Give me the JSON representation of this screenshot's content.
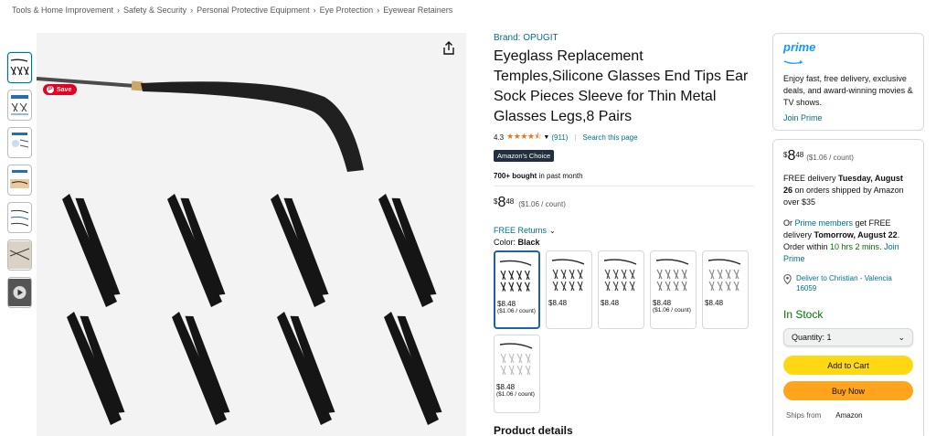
{
  "breadcrumb": [
    "Tools & Home Improvement",
    "Safety & Security",
    "Personal Protective Equipment",
    "Eye Protection",
    "Eyewear Retainers"
  ],
  "breadcrumb_separator": "›",
  "gallery": {
    "save_label": "Save",
    "thumbnail_icons": [
      "product-thumbnail",
      "infographic-thumbnail",
      "infographic-thumbnail",
      "infographic-thumbnail",
      "infographic-thumbnail",
      "lifestyle-thumbnail",
      "video-thumbnail"
    ]
  },
  "product": {
    "brand": "Brand: OPUGIT",
    "title": "Eyeglass Replacement Temples,Silicone Glasses End Tips Ear Sock Pieces Sleeve for Thin Metal Glasses Legs,8 Pairs",
    "rating": "4.3",
    "stars": "★★★★⯪",
    "rating_count": "(911)",
    "search_link": "Search this page",
    "badge": "Amazon's Choice",
    "bought_bold": "700+ bought",
    "bought_rest": " in past month",
    "price_symbol": "$",
    "price_whole": "8",
    "price_fraction": "48",
    "price_per_unit": "($1.06 / count)",
    "returns": "FREE Returns",
    "color_label": "Color: ",
    "color_value": "Black",
    "swatches": [
      {
        "price": "$8.48",
        "unit": "($1.06 / count)"
      },
      {
        "price": "$8.48",
        "unit": ""
      },
      {
        "price": "$8.48",
        "unit": ""
      },
      {
        "price": "$8.48",
        "unit": "($1.06 / count)"
      },
      {
        "price": "$8.48",
        "unit": ""
      },
      {
        "price": "$8.48",
        "unit": "($1.06 / count)"
      }
    ],
    "details_heading": "Product details"
  },
  "prime": {
    "logo": "prime",
    "text": "Enjoy fast, free delivery, exclusive deals, and award-winning movies & TV shows.",
    "join": "Join Prime"
  },
  "buybox": {
    "price_symbol": "$",
    "price_whole": "8",
    "price_fraction": "48",
    "price_per_unit": "($1.06 / count)",
    "free_delivery_prefix": "FREE delivery ",
    "free_delivery_date": "Tuesday, August 26",
    "free_delivery_suffix": " on orders shipped by Amazon over $35",
    "or_prefix": "Or ",
    "prime_members": "Prime members",
    "fast_mid": " get FREE delivery ",
    "fast_date": "Tomorrow, August 22",
    "order_within": ". Order within ",
    "countdown": "10 hrs 2 mins",
    "join_prime": "Join Prime",
    "deliver_to": "Deliver to Christian - Valencia 16059",
    "stock": "In Stock",
    "quantity": "Quantity: 1",
    "add_to_cart": "Add to Cart",
    "buy_now": "Buy Now",
    "ships_from_label": "Ships from",
    "ships_from_value": "Amazon"
  },
  "colors": {
    "link": "#007185",
    "star": "#de7921",
    "in_stock": "#007600",
    "cart_button": "#ffd814",
    "buy_button": "#ffa41c",
    "prime_blue": "#1399ff",
    "badge_bg": "#232f3e"
  }
}
